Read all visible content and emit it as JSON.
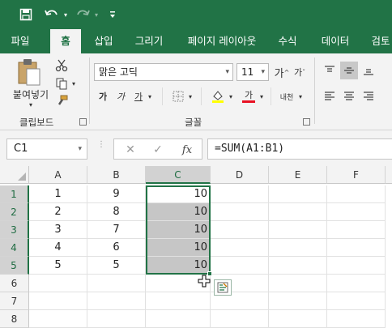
{
  "quick_access": {
    "save_icon": "save-icon",
    "undo_icon": "undo-icon",
    "redo_icon": "redo-icon",
    "customize_icon": "customize-qat-icon"
  },
  "tabs": [
    "파일",
    "홈",
    "삽입",
    "그리기",
    "페이지 레이아웃",
    "수식",
    "데이터",
    "검토"
  ],
  "active_tab": "홈",
  "ribbon": {
    "clipboard": {
      "paste_label": "붙여넣기",
      "group_label": "클립보드"
    },
    "font": {
      "font_name": "맑은 고딕",
      "font_size": "11",
      "increase_size": "가",
      "decrease_size": "가",
      "bold": "가",
      "italic": "가",
      "underline": "가",
      "font_color_label": "가",
      "phonetic": "내천",
      "group_label": "글꼴"
    }
  },
  "name_box": "C1",
  "formula_fx": "fx",
  "formula": "=SUM(A1:B1)",
  "columns": [
    "A",
    "B",
    "C",
    "D",
    "E",
    "F"
  ],
  "selected_column": "C",
  "rows": [
    "1",
    "2",
    "3",
    "4",
    "5",
    "6",
    "7",
    "8"
  ],
  "cells": [
    [
      "1",
      "9",
      "10"
    ],
    [
      "2",
      "8",
      "10"
    ],
    [
      "3",
      "7",
      "10"
    ],
    [
      "4",
      "6",
      "10"
    ],
    [
      "5",
      "5",
      "10"
    ]
  ],
  "colors": {
    "brand": "#217346",
    "selection_fill": "#c6c6c6",
    "font_color_bar": "#e81123",
    "fill_color_bar": "#ffff00"
  }
}
